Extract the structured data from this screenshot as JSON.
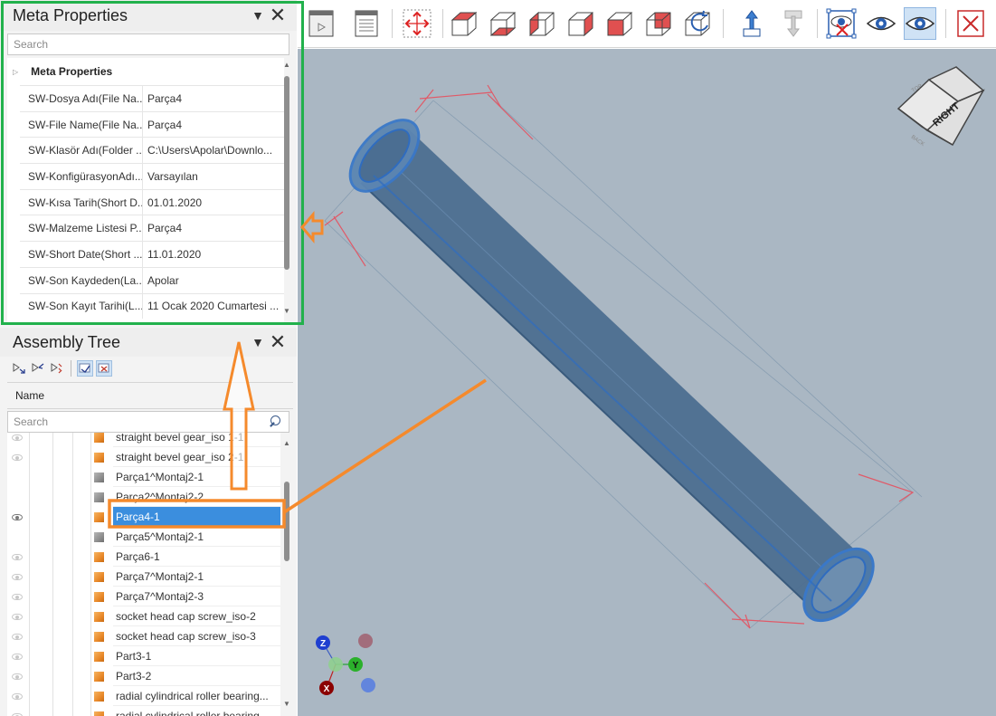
{
  "meta": {
    "title": "Meta Properties",
    "search_placeholder": "Search",
    "group_label": "Meta Properties",
    "rows": [
      {
        "key": "SW-Dosya Adı(File Na...",
        "value": "Parça4"
      },
      {
        "key": "SW-File Name(File Na...",
        "value": "Parça4"
      },
      {
        "key": "SW-Klasör Adı(Folder ...",
        "value": "C:\\Users\\Apolar\\Downlo..."
      },
      {
        "key": "SW-KonfigürasyonAdı...",
        "value": "Varsayılan"
      },
      {
        "key": "SW-Kısa Tarih(Short D...",
        "value": "01.01.2020"
      },
      {
        "key": "SW-Malzeme Listesi P...",
        "value": "Parça4"
      },
      {
        "key": "SW-Short Date(Short ...",
        "value": "11.01.2020"
      },
      {
        "key": "SW-Son Kaydeden(La...",
        "value": "Apolar"
      },
      {
        "key": "SW-Son Kayıt Tarihi(L...",
        "value": "11 Ocak 2020 Cumartesi ..."
      }
    ]
  },
  "assembly": {
    "title": "Assembly Tree",
    "column_name": "Name",
    "search_placeholder": "Search",
    "items": [
      {
        "label": "straight bevel gear_iso 1-1",
        "icon": "orange",
        "eye": "light"
      },
      {
        "label": "straight bevel gear_iso 2-1",
        "icon": "orange",
        "eye": "light"
      },
      {
        "label": "Parça1^Montaj2-1",
        "icon": "gray",
        "eye": "none"
      },
      {
        "label": "Parça2^Montaj2-2",
        "icon": "gray",
        "eye": "none"
      },
      {
        "label": "Parça4-1",
        "icon": "orange",
        "eye": "dark",
        "selected": true
      },
      {
        "label": "Parça5^Montaj2-1",
        "icon": "gray",
        "eye": "none"
      },
      {
        "label": "Parça6-1",
        "icon": "orange",
        "eye": "light"
      },
      {
        "label": "Parça7^Montaj2-1",
        "icon": "orange",
        "eye": "light"
      },
      {
        "label": "Parça7^Montaj2-3",
        "icon": "orange",
        "eye": "light"
      },
      {
        "label": "socket head cap screw_iso-2",
        "icon": "orange",
        "eye": "light"
      },
      {
        "label": "socket head cap screw_iso-3",
        "icon": "orange",
        "eye": "light"
      },
      {
        "label": "Part3-1",
        "icon": "orange",
        "eye": "light"
      },
      {
        "label": "Part3-2",
        "icon": "orange",
        "eye": "light"
      },
      {
        "label": "radial cylindrical roller bearing...",
        "icon": "orange",
        "eye": "light"
      },
      {
        "label": "radial cylindrical roller bearing...",
        "icon": "orange",
        "eye": "light"
      }
    ]
  },
  "viewcube": {
    "face_label": "RIGHT"
  },
  "axis_triad": {
    "z": "Z",
    "y": "Y",
    "x": "X"
  },
  "colors": {
    "highlight_frame": "#22b14c",
    "annotation_arrow": "#f58a2c",
    "selection": "#3b8ede",
    "viewport_bg": "#aab7c3",
    "part_fill": "#4d6f92"
  }
}
